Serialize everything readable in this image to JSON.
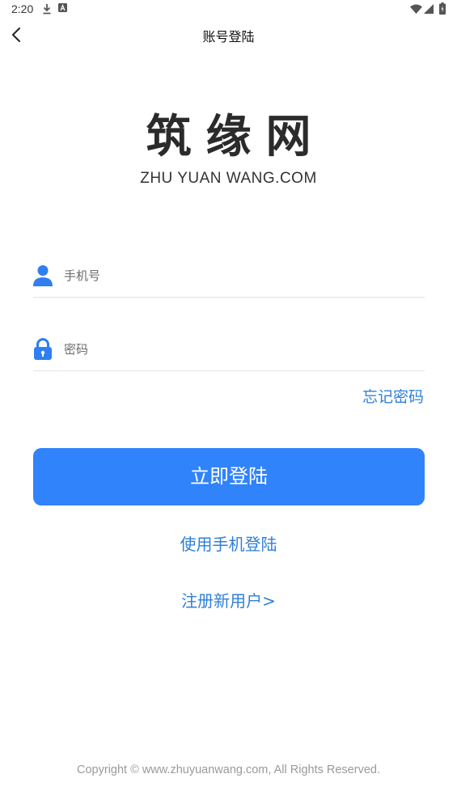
{
  "status_bar": {
    "time": "2:20",
    "icons": [
      "download-icon",
      "a-icon",
      "wifi-icon",
      "signal-icon",
      "battery-icon"
    ]
  },
  "header": {
    "title": "账号登陆",
    "back_icon": "chevron-left-icon"
  },
  "logo": {
    "main": "筑缘网",
    "sub": "ZHU YUAN WANG.COM"
  },
  "form": {
    "phone": {
      "placeholder": "手机号",
      "value": "",
      "icon": "user-icon"
    },
    "password": {
      "placeholder": "密码",
      "value": "",
      "icon": "lock-icon"
    },
    "forgot_label": "忘记密码",
    "login_label": "立即登陆",
    "phone_login_label": "使用手机登陆",
    "register_label": "注册新用户>"
  },
  "footer": {
    "copyright": "Copyright © www.zhuyuanwang.com, All Rights Reserved."
  },
  "colors": {
    "accent": "#3083fb",
    "link": "#2e7fd8",
    "icon": "#2f7ff0"
  }
}
